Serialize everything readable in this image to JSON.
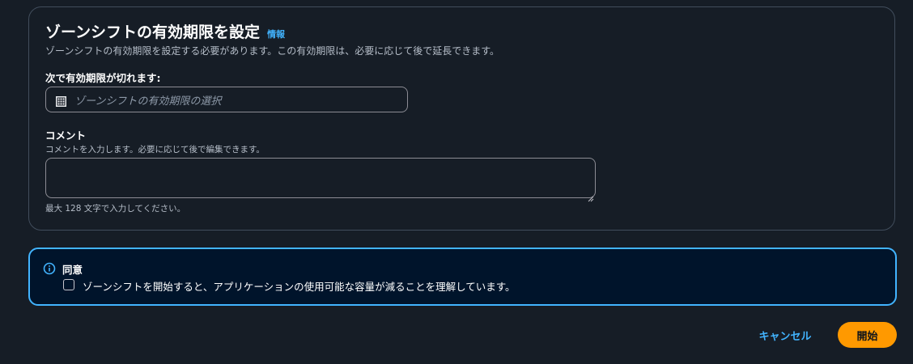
{
  "expiry_panel": {
    "title": "ゾーンシフトの有効期限を設定",
    "info_link": "情報",
    "description": "ゾーンシフトの有効期限を設定する必要があります。この有効期限は、必要に応じて後で延長できます。",
    "expiry_label": "次で有効期限が切れます:",
    "expiry_placeholder": "ゾーンシフトの有効期限の選択",
    "expiry_icon": "calendar-icon",
    "comment_label": "コメント",
    "comment_description": "コメントを入力します。必要に応じて後で編集できます。",
    "comment_value": "",
    "comment_hint": "最大 128 文字で入力してください。"
  },
  "consent": {
    "icon": "info-icon",
    "title": "同意",
    "checkbox_label": "ゾーンシフトを開始すると、アプリケーションの使用可能な容量が減ることを理解しています。",
    "checked": false
  },
  "actions": {
    "cancel_label": "キャンセル",
    "start_label": "開始"
  },
  "colors": {
    "background": "#161d26",
    "accent_link": "#42b4ff",
    "primary_button": "#ff9900",
    "alert_background": "#00142b"
  }
}
